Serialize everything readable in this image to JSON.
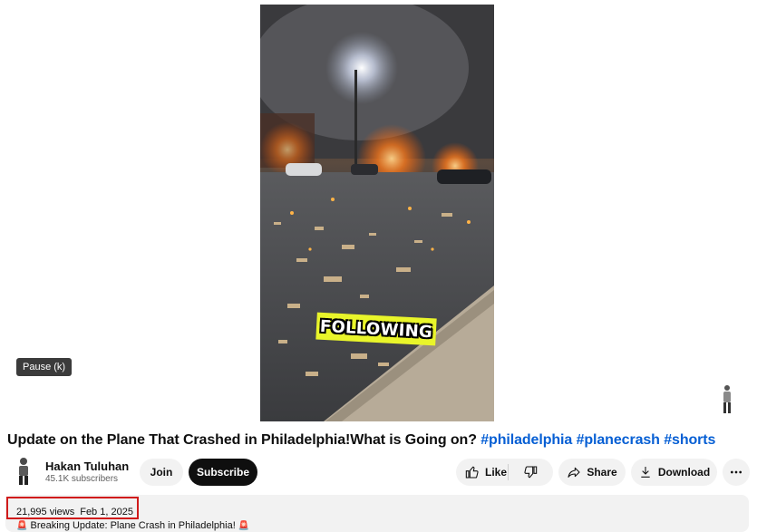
{
  "player": {
    "pause_tooltip": "Pause (k)",
    "caption_text": "FOLLOWING"
  },
  "video": {
    "title_text": "Update on the Plane That Crashed in Philadelphia!What is Going on?",
    "hashtags": [
      "#philadelphia",
      "#planecrash",
      "#shorts"
    ]
  },
  "channel": {
    "name": "Hakan Tuluhan",
    "subscribers": "45.1K subscribers"
  },
  "actions": {
    "join": "Join",
    "subscribe": "Subscribe",
    "like": "Like",
    "share": "Share",
    "download": "Download"
  },
  "description": {
    "views": "21,995 views",
    "date": "Feb 1, 2025",
    "siren": "🚨",
    "first_line": "Breaking Update: Plane Crash in Philadelphia!"
  },
  "colors": {
    "hashtag": "#065fd4",
    "highlight_box": "#d01b1b",
    "subscribe_bg": "#0f0f0f"
  }
}
